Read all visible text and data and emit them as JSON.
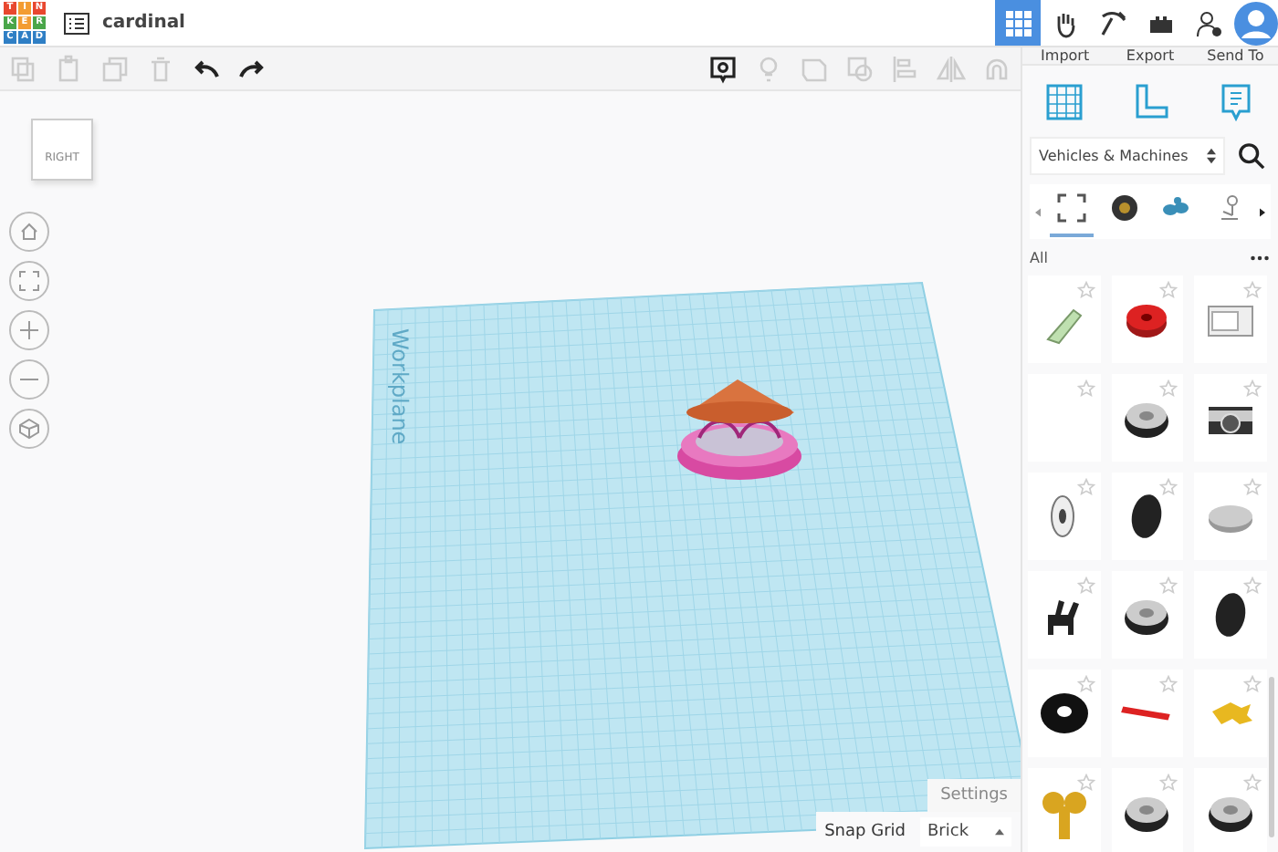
{
  "logo": {
    "letters": [
      "T",
      "I",
      "N",
      "K",
      "E",
      "R",
      "C",
      "A",
      "D"
    ]
  },
  "design": {
    "title": "cardinal"
  },
  "top_icons": [
    {
      "kind": "grid",
      "selected": true
    },
    {
      "kind": "hand",
      "selected": false
    },
    {
      "kind": "pickaxe",
      "selected": false
    },
    {
      "kind": "brick",
      "selected": false
    },
    {
      "kind": "user-add",
      "selected": false
    }
  ],
  "toolbar": {
    "left": [
      {
        "kind": "copy",
        "disabled": true
      },
      {
        "kind": "paste",
        "disabled": true
      },
      {
        "kind": "duplicate",
        "disabled": true
      },
      {
        "kind": "delete",
        "disabled": true
      },
      {
        "kind": "undo",
        "disabled": false
      },
      {
        "kind": "redo",
        "disabled": false
      }
    ],
    "right": [
      {
        "kind": "note",
        "disabled": false
      },
      {
        "kind": "bulb",
        "disabled": true
      },
      {
        "kind": "shape",
        "disabled": true
      },
      {
        "kind": "group",
        "disabled": true
      },
      {
        "kind": "align",
        "disabled": true
      },
      {
        "kind": "mirror",
        "disabled": true
      },
      {
        "kind": "magnet",
        "disabled": true
      }
    ]
  },
  "actions": [
    "Import",
    "Export",
    "Send To"
  ],
  "panel_tools": [
    {
      "kind": "workplane"
    },
    {
      "kind": "ruler"
    },
    {
      "kind": "notes"
    }
  ],
  "library": {
    "value": "Vehicles & Machines",
    "categories": [
      {
        "kind": "all",
        "selected": true
      },
      {
        "kind": "wheel",
        "selected": false
      },
      {
        "kind": "vehicle",
        "selected": false
      },
      {
        "kind": "robot",
        "selected": false
      }
    ],
    "filter": "All"
  },
  "parts": [
    {
      "kind": "bottle"
    },
    {
      "kind": "ring"
    },
    {
      "kind": "oven"
    },
    {
      "kind": "blank"
    },
    {
      "kind": "wheel"
    },
    {
      "kind": "camera"
    },
    {
      "kind": "rim"
    },
    {
      "kind": "tire"
    },
    {
      "kind": "hub"
    },
    {
      "kind": "chair"
    },
    {
      "kind": "wheel"
    },
    {
      "kind": "tire"
    },
    {
      "kind": "donut"
    },
    {
      "kind": "rod"
    },
    {
      "kind": "claw"
    },
    {
      "kind": "key"
    },
    {
      "kind": "wheel"
    },
    {
      "kind": "wheel"
    }
  ],
  "view_cube": {
    "face": "RIGHT"
  },
  "nav_buttons": [
    {
      "kind": "home"
    },
    {
      "kind": "fit"
    },
    {
      "kind": "zoom-in"
    },
    {
      "kind": "zoom-out"
    },
    {
      "kind": "perspective"
    }
  ],
  "workplane": {
    "label": "Workplane"
  },
  "settings": "Settings",
  "snap_grid": {
    "label": "Snap Grid",
    "value": "Brick"
  }
}
